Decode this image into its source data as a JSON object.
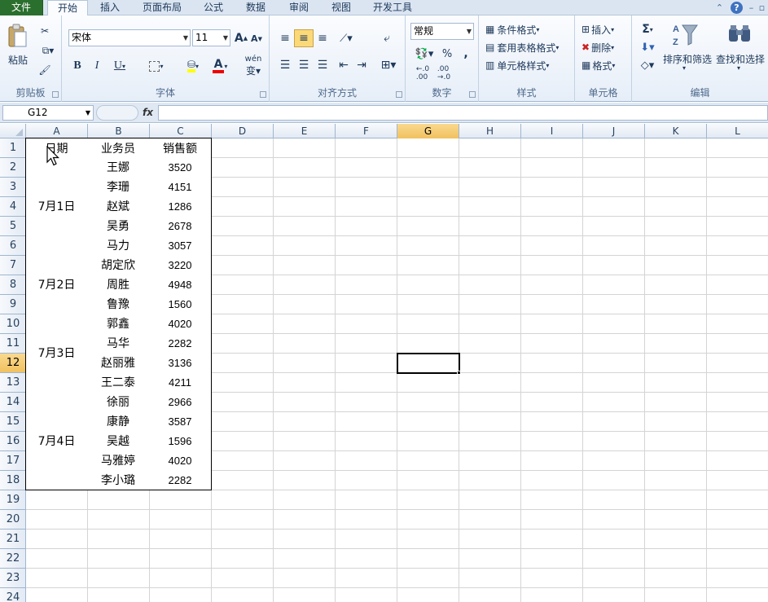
{
  "tabs": {
    "file": "文件",
    "home": "开始",
    "insert": "插入",
    "layout": "页面布局",
    "formulas": "公式",
    "data": "数据",
    "review": "审阅",
    "view": "视图",
    "developer": "开发工具"
  },
  "clipboard": {
    "paste": "粘贴",
    "group": "剪贴板"
  },
  "font": {
    "name": "宋体",
    "size": "11",
    "group": "字体",
    "wen": "wén"
  },
  "align": {
    "group": "对齐方式"
  },
  "number": {
    "format": "常规",
    "percent": "%",
    "comma": ",",
    "group": "数字"
  },
  "styles": {
    "conditional": "条件格式",
    "table": "套用表格格式",
    "cell": "单元格样式",
    "group": "样式"
  },
  "cellsgrp": {
    "insert": "插入",
    "delete": "删除",
    "format": "格式",
    "group": "单元格"
  },
  "editing": {
    "sigma": "Σ",
    "sort": "排序和筛选",
    "find": "查找和选择",
    "group": "编辑"
  },
  "formula_bar": {
    "name_box": "G12",
    "fx": "fx",
    "formula": ""
  },
  "columns": [
    "A",
    "B",
    "C",
    "D",
    "E",
    "F",
    "G",
    "H",
    "I",
    "J",
    "K",
    "L"
  ],
  "rows": [
    "1",
    "2",
    "3",
    "4",
    "5",
    "6",
    "7",
    "8",
    "9",
    "10",
    "11",
    "12",
    "13",
    "14",
    "15",
    "16",
    "17",
    "18",
    "19",
    "20",
    "21",
    "22",
    "23",
    "24"
  ],
  "selected": {
    "column": "G",
    "row": "12"
  },
  "sheet": {
    "headers": [
      "日期",
      "业务员",
      "销售额"
    ],
    "dates": [
      {
        "label": "7月1日"
      },
      {
        "label": "7月2日"
      },
      {
        "label": "7月3日"
      },
      {
        "label": "7月4日"
      }
    ],
    "records": [
      {
        "name": "王娜",
        "sales": "3520"
      },
      {
        "name": "李珊",
        "sales": "4151"
      },
      {
        "name": "赵斌",
        "sales": "1286"
      },
      {
        "name": "吴勇",
        "sales": "2678"
      },
      {
        "name": "马力",
        "sales": "3057"
      },
      {
        "name": "胡定欣",
        "sales": "3220"
      },
      {
        "name": "周胜",
        "sales": "4948"
      },
      {
        "name": "鲁豫",
        "sales": "1560"
      },
      {
        "name": "郭鑫",
        "sales": "4020"
      },
      {
        "name": "马华",
        "sales": "2282"
      },
      {
        "name": "赵丽雅",
        "sales": "3136"
      },
      {
        "name": "王二泰",
        "sales": "4211"
      },
      {
        "name": "徐丽",
        "sales": "2966"
      },
      {
        "name": "康静",
        "sales": "3587"
      },
      {
        "name": "吴越",
        "sales": "1596"
      },
      {
        "name": "马雅婷",
        "sales": "4020"
      },
      {
        "name": "李小璐",
        "sales": "2282"
      }
    ]
  },
  "colors": {
    "file_tab": "#2a6f2d",
    "selected_header": "#f1c15f",
    "ribbon": "#e6eef8"
  }
}
